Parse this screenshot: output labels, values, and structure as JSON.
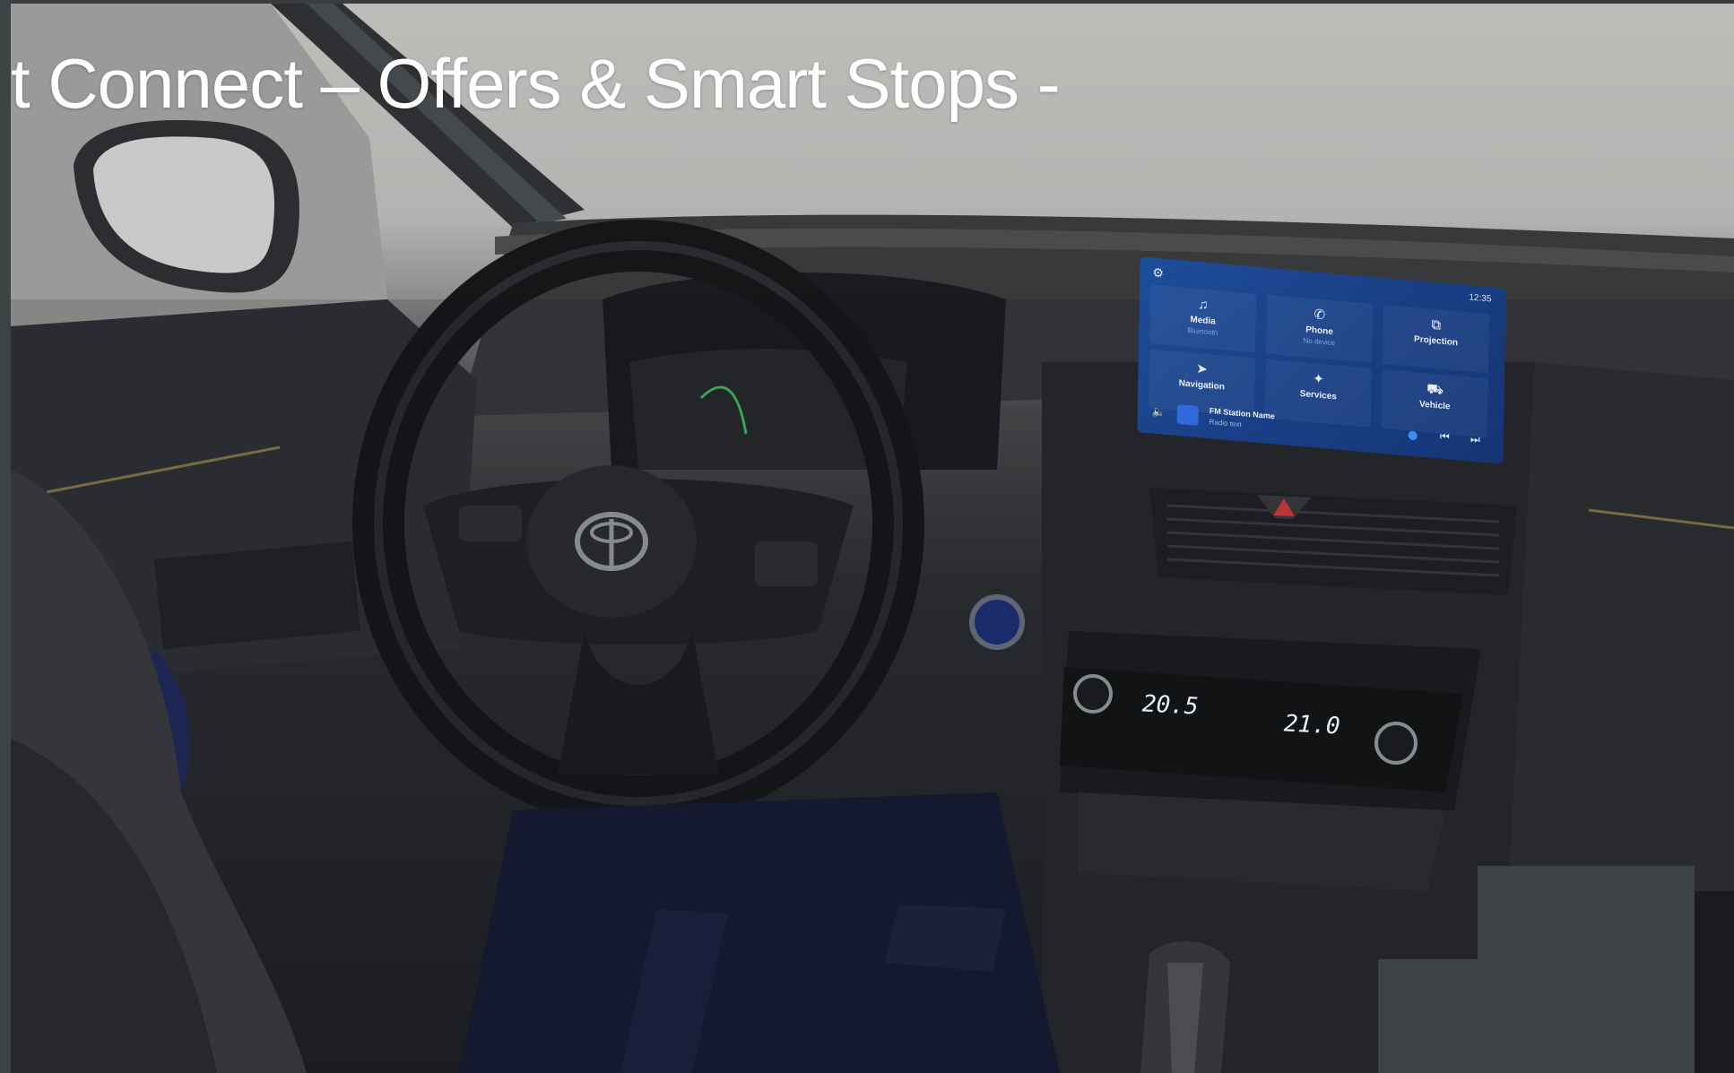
{
  "slide": {
    "title": "t Connect – Offers & Smart Stops -"
  },
  "infotainment": {
    "status_time": "12:35",
    "tiles": [
      {
        "icon": "music-note-icon",
        "label": "Media",
        "sub": "Bluetooth"
      },
      {
        "icon": "phone-icon",
        "label": "Phone",
        "sub": "No device"
      },
      {
        "icon": "projection-icon",
        "label": "Projection",
        "sub": ""
      },
      {
        "icon": "navigation-icon",
        "label": "Navigation",
        "sub": ""
      },
      {
        "icon": "services-icon",
        "label": "Services",
        "sub": ""
      },
      {
        "icon": "vehicle-icon",
        "label": "Vehicle",
        "sub": ""
      }
    ],
    "radio": {
      "station": "FM Station Name",
      "text": "Radio text"
    }
  },
  "climate": {
    "left_temp": "20.5",
    "right_temp": "21.0"
  },
  "colors": {
    "screen_blue": "#1a3f86",
    "accent_blue": "#2f6ad8",
    "frame_gray": "#3e4245"
  }
}
